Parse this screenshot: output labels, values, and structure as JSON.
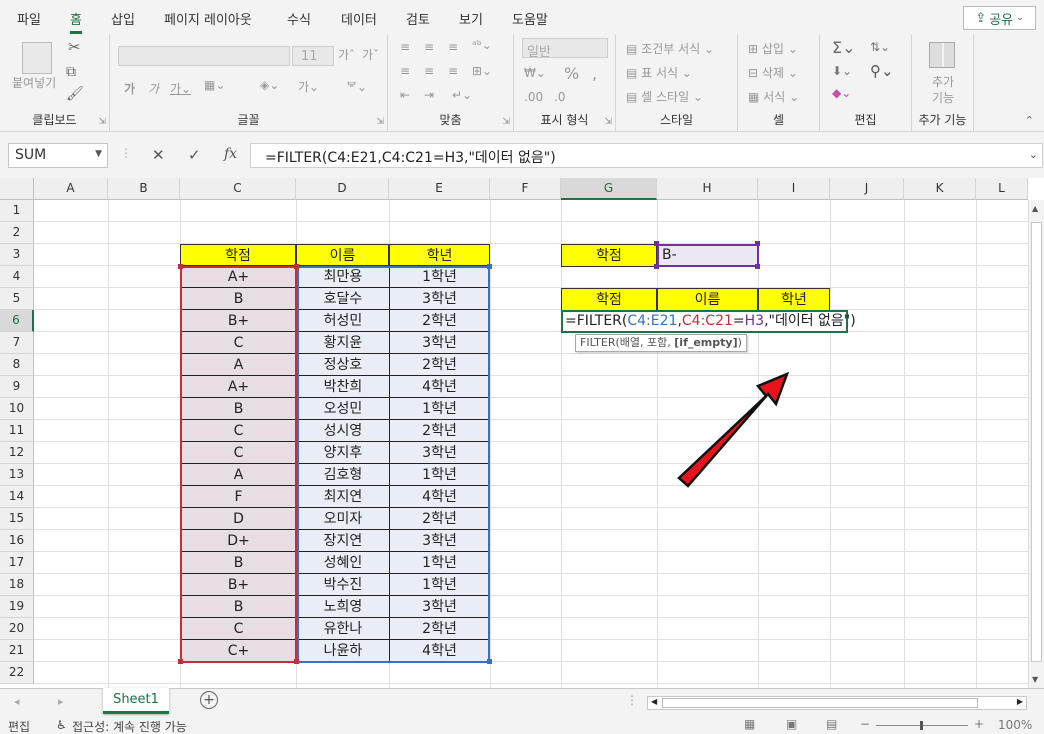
{
  "tabs": [
    "파일",
    "홈",
    "삽입",
    "페이지 레이아웃",
    "수식",
    "데이터",
    "검토",
    "보기",
    "도움말"
  ],
  "share_label": "공유",
  "ribbon": {
    "clipboard_label": "클립보드",
    "paste_label": "붙여넣기",
    "font_label": "글꼴",
    "font_size": "11",
    "align_label": "맞춤",
    "number_label": "표시 형식",
    "number_format": "일반",
    "styles_label": "스타일",
    "cond_format": "조건부 서식",
    "table_format": "표 서식",
    "cell_styles": "셀 스타일",
    "cells_label": "셀",
    "insert": "삽입",
    "delete": "삭제",
    "format": "서식",
    "edit_label": "편집",
    "addins_label": "추가 기능",
    "addins_btn": "추가 기능"
  },
  "namebox": "SUM",
  "formula": "=FILTER(C4:E21,C4:C21=H3,\"데이터 없음\")",
  "columns": [
    "A",
    "B",
    "C",
    "D",
    "E",
    "F",
    "G",
    "H",
    "I",
    "J",
    "K",
    "L"
  ],
  "rows": [
    "1",
    "2",
    "3",
    "4",
    "5",
    "6",
    "7",
    "8",
    "9",
    "10",
    "11",
    "12",
    "13",
    "14",
    "15",
    "16",
    "17",
    "18",
    "19",
    "20",
    "21",
    "22"
  ],
  "table": {
    "headers": [
      "학점",
      "이름",
      "학년"
    ],
    "rows": [
      [
        "A+",
        "최만용",
        "1학년"
      ],
      [
        "B",
        "호달수",
        "3학년"
      ],
      [
        "B+",
        "허성민",
        "2학년"
      ],
      [
        "C",
        "황지윤",
        "3학년"
      ],
      [
        "A",
        "정상호",
        "2학년"
      ],
      [
        "A+",
        "박찬희",
        "4학년"
      ],
      [
        "B",
        "오성민",
        "1학년"
      ],
      [
        "C",
        "성시영",
        "2학년"
      ],
      [
        "C",
        "양지후",
        "3학년"
      ],
      [
        "A",
        "김호형",
        "1학년"
      ],
      [
        "F",
        "최지연",
        "4학년"
      ],
      [
        "D",
        "오미자",
        "2학년"
      ],
      [
        "D+",
        "장지연",
        "3학년"
      ],
      [
        "B",
        "성혜인",
        "1학년"
      ],
      [
        "B+",
        "박수진",
        "1학년"
      ],
      [
        "B",
        "노희영",
        "3학년"
      ],
      [
        "C",
        "유한나",
        "2학년"
      ],
      [
        "C+",
        "나윤하",
        "4학년"
      ]
    ]
  },
  "criteria": {
    "label": "학점",
    "value": "B-"
  },
  "result_headers": [
    "학점",
    "이름",
    "학년"
  ],
  "edit": {
    "p1": "=FILTER(",
    "p2": "C4:E21",
    ",1": ",",
    "p3": "C4:C21",
    "p4": "=",
    "p5": "H3",
    "p6": ",\"데이터 없음\")"
  },
  "tooltip": {
    "text": "FILTER(배열, 포함, ",
    "bold": "[if_empty]",
    "end": ")"
  },
  "sheet_tab": "Sheet1",
  "status": {
    "mode": "편집",
    "accessibility": "접근성: 계속 진행 가능",
    "zoom": "100%"
  },
  "colors": {
    "accent": "#217346",
    "header_fill": "#ffff00",
    "arrow": "#e8141b"
  }
}
